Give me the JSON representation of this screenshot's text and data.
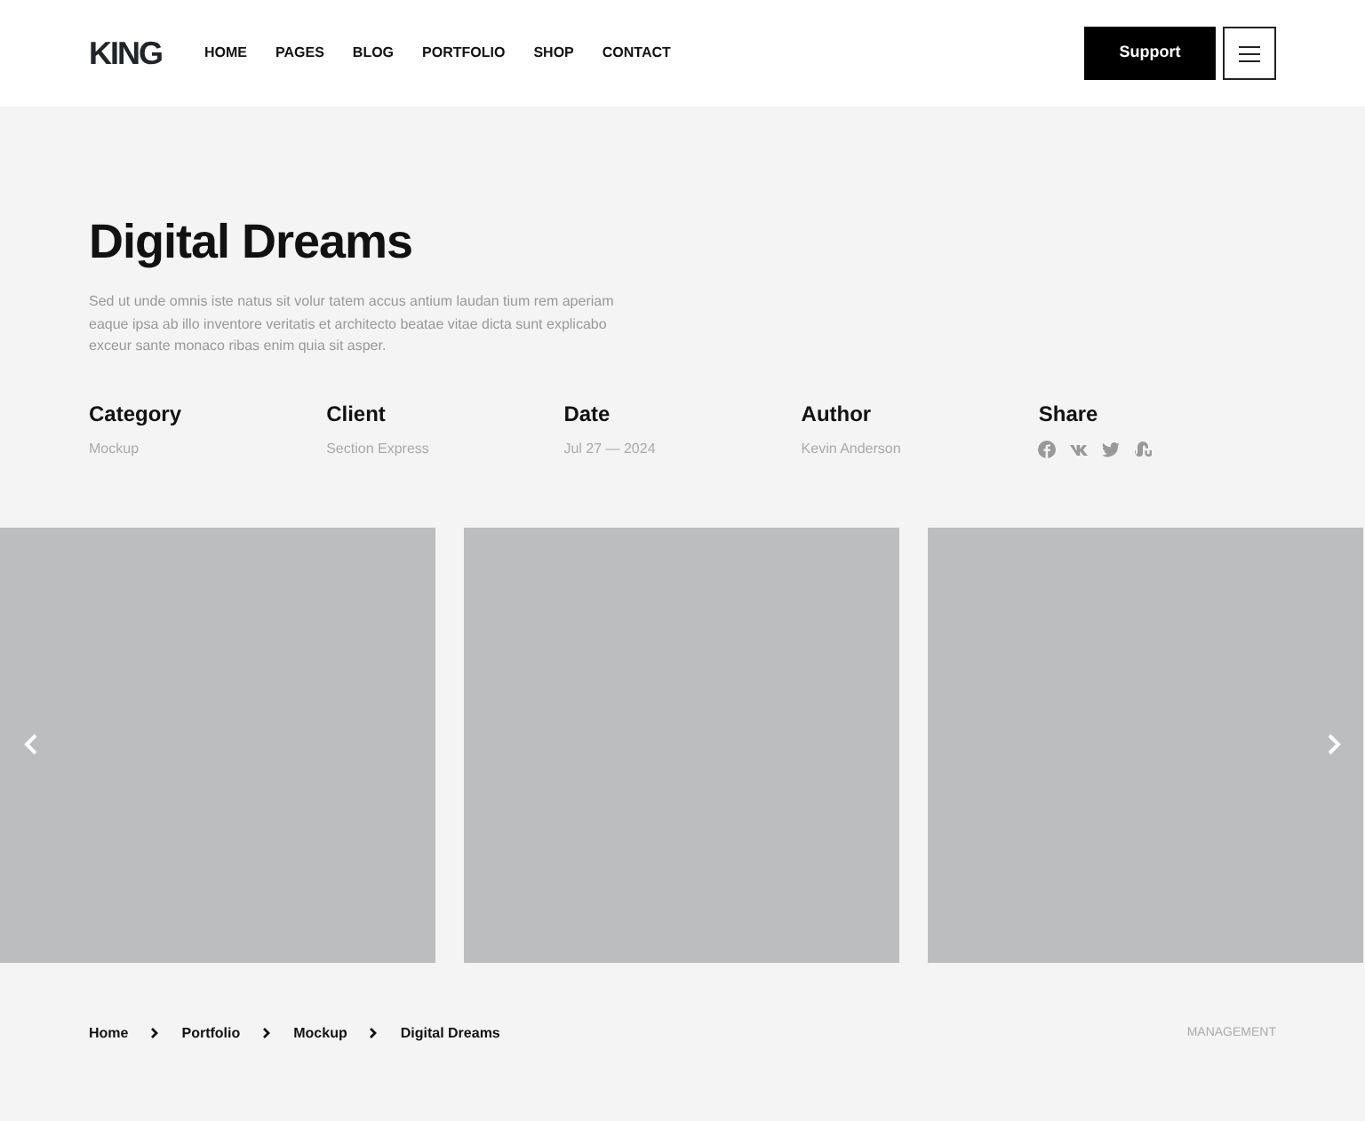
{
  "logo": "KING",
  "nav": [
    {
      "label": "HOME"
    },
    {
      "label": "PAGES"
    },
    {
      "label": "BLOG"
    },
    {
      "label": "PORTFOLIO"
    },
    {
      "label": "SHOP"
    },
    {
      "label": "CONTACT"
    }
  ],
  "support_button": "Support",
  "title": "Digital Dreams",
  "description": "Sed ut unde omnis iste natus sit volur tatem accus antium laudan tium rem aperiam eaque ipsa ab illo inventore veritatis et architecto beatae vitae dicta sunt explicabo exceur sante monaco ribas enim quia sit asper.",
  "meta": [
    {
      "kind": "text",
      "label": "Category",
      "value": "Mockup"
    },
    {
      "kind": "text",
      "label": "Client",
      "value": "Section Express"
    },
    {
      "kind": "text",
      "label": "Date",
      "value": "Jul 27 — 2024"
    },
    {
      "kind": "text",
      "label": "Author",
      "value": "Kevin Anderson"
    },
    {
      "kind": "share",
      "label": "Share"
    }
  ],
  "slides": [
    {
      "kind": "picture"
    },
    {
      "kind": "picture"
    },
    {
      "kind": "picture"
    }
  ],
  "breadcrumb": [
    "Home",
    "Portfolio",
    "Mockup",
    "Digital Dreams"
  ],
  "tag": "MANAGEMENT"
}
